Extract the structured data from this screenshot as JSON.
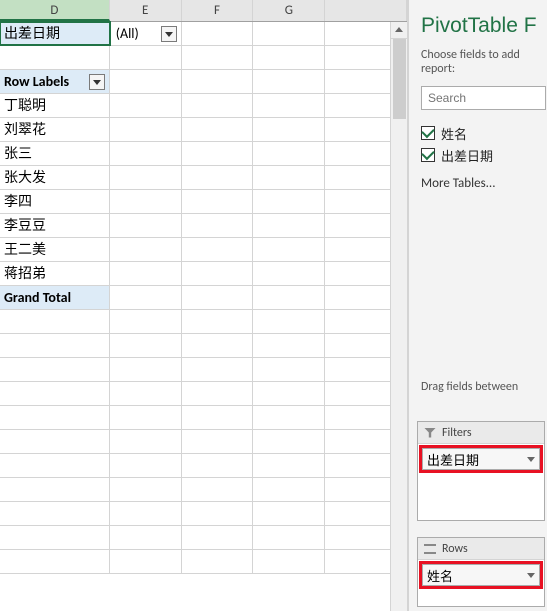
{
  "columns": {
    "d": "D",
    "e": "E",
    "f": "F",
    "g": "G"
  },
  "pivot": {
    "filter_field": "出差日期",
    "filter_value": "(All)",
    "row_labels_header": "Row Labels",
    "rows": [
      "丁聪明",
      "刘翠花",
      "张三",
      "张大发",
      "李四",
      "李豆豆",
      "王二美",
      "蒋招弟"
    ],
    "grand_total": "Grand Total"
  },
  "panel": {
    "title": "PivotTable F",
    "desc": "Choose fields to add report:",
    "search_placeholder": "Search",
    "fields": {
      "name": {
        "label": "姓名",
        "checked": true
      },
      "date": {
        "label": "出差日期",
        "checked": true
      }
    },
    "more_tables": "More Tables...",
    "drag_hint": "Drag fields between",
    "filters_label": "Filters",
    "filters_item": "出差日期",
    "rows_label": "Rows",
    "rows_item": "姓名"
  }
}
